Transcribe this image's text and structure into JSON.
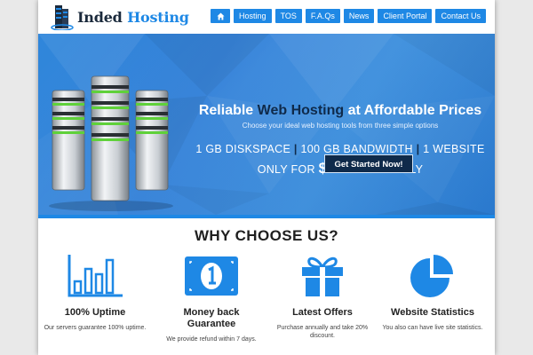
{
  "brand": {
    "name_dark": "Inded",
    "name_accent": "Hosting"
  },
  "nav": {
    "home_icon": "home-icon",
    "items": [
      "Hosting",
      "TOS",
      "F.A.Qs",
      "News",
      "Client Portal",
      "Contact Us"
    ]
  },
  "hero": {
    "title_part1": "Reliable",
    "title_part2": "Web Hosting",
    "title_part3": "at Affordable Prices",
    "subtitle": "Choose your ideal web hosting tools from three simple options",
    "spec_diskspace": "1 GB DISKSPACE",
    "spec_sep": "|",
    "spec_bandwidth": "100 GB BANDWIDTH",
    "spec_websites": "1 WEBSITE",
    "price_prefix": "ONLY FOR",
    "price_amount": "$0.49",
    "price_suffix": "/ MONTHLY",
    "cta_label": "Get Started Now!"
  },
  "why": {
    "title": "WHY CHOOSE US?",
    "features": [
      {
        "icon": "bar-chart-icon",
        "title": "100% Uptime",
        "desc": "Our servers guarantee 100% uptime."
      },
      {
        "icon": "money-icon",
        "title_line1": "Money back",
        "title_line2": "Guarantee",
        "desc": "We provide refund within 7 days."
      },
      {
        "icon": "gift-icon",
        "title": "Latest Offers",
        "desc": "Purchase annually and take 20% discount."
      },
      {
        "icon": "pie-chart-icon",
        "title": "Website Statistics",
        "desc": "You also can have live site statistics."
      }
    ]
  },
  "colors": {
    "accent": "#1e88e5",
    "dark": "#0f2a4a",
    "hero": "#2f86db"
  }
}
